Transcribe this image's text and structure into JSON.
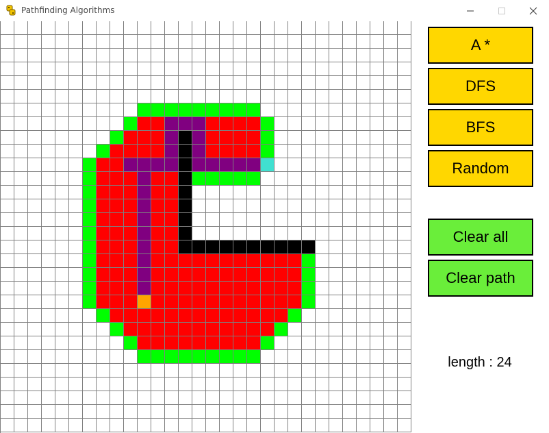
{
  "window": {
    "title": "Pathfinding Algorithms"
  },
  "buttons": [
    {
      "label": "A *",
      "color": "#ffd700"
    },
    {
      "label": "DFS",
      "color": "#ffd700"
    },
    {
      "label": "BFS",
      "color": "#ffd700"
    },
    {
      "label": "Random",
      "color": "#ffd700"
    },
    {
      "label": "Clear all",
      "color": "#6aee3a"
    },
    {
      "label": "Clear path",
      "color": "#6aee3a"
    }
  ],
  "status": {
    "length_text": "length : 24"
  },
  "grid": {
    "cols": 30,
    "rows": 30,
    "legend": {
      ".": {
        "state": "empty",
        "color": "#ffffff"
      },
      "G": {
        "state": "open",
        "color": "#00ff00"
      },
      "R": {
        "state": "closed",
        "color": "#ff0000"
      },
      "B": {
        "state": "barrier",
        "color": "#000000"
      },
      "P": {
        "state": "path",
        "color": "#800080"
      },
      "S": {
        "state": "start",
        "color": "#ffa500"
      },
      "E": {
        "state": "end",
        "color": "#40e0d0"
      }
    },
    "cells": [
      "..............................",
      "..............................",
      "..............................",
      "..............................",
      "..............................",
      "..............................",
      "..........GGGGGGGGG...........",
      ".........GRRPPPRRRRG..........",
      "........GRRRPBPRRRRG..........",
      ".......GRRRRPBPRRRRG..........",
      "......GRRPPPPBPPPPPE..........",
      "......GRRRPRRBGGGGG...........",
      "......GRRRPRRB................",
      "......GRRRPRRB................",
      "......GRRRPRRB................",
      "......GRRRPRRB................",
      "......GRRRPRRBBBBBBBBBB.......",
      "......GRRRPRRRRRRRRRRRG.......",
      "......GRRRPRRRRRRRRRRRG.......",
      "......GRRRPRRRRRRRRRRRG.......",
      "......GRRRSRRRRRRRRRRRG.......",
      ".......GRRRRRRRRRRRRRG........",
      "........GRRRRRRRRRRRG.........",
      ".........GRRRRRRRRRG..........",
      "..........GGGGGGGGG...........",
      "..............................",
      "..............................",
      "..............................",
      "..............................",
      ".............................."
    ]
  }
}
